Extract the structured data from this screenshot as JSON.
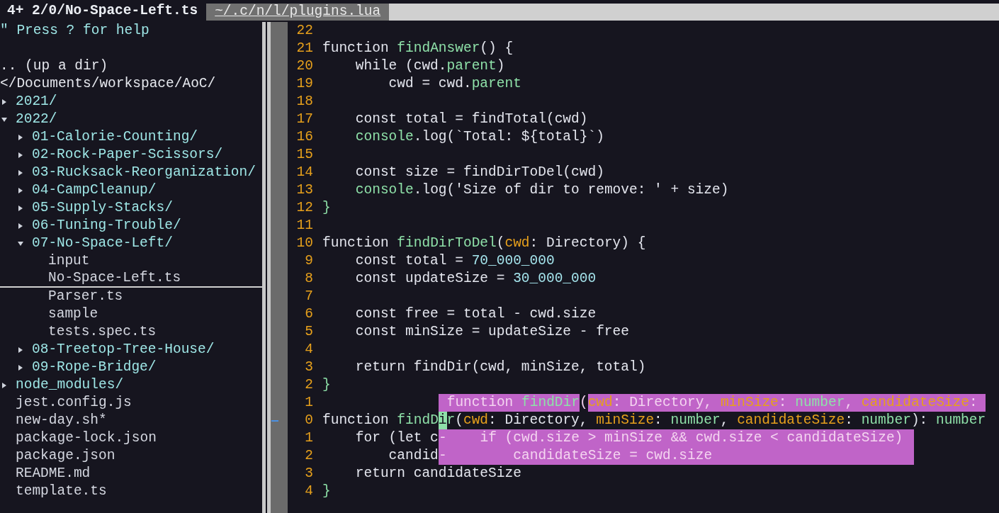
{
  "tabs": [
    {
      "label": "4+ 2/0/No-Space-Left.ts",
      "selected": true
    },
    {
      "label": "~/.c/n/l/plugins.lua",
      "selected": false
    }
  ],
  "tree": {
    "help": "\" Press ? for help",
    "up": ".. (up a dir)",
    "root": "</Documents/workspace/AoC/",
    "items": [
      {
        "name": "2021/",
        "kind": "dir",
        "expanded": false,
        "selected": false
      },
      {
        "name": "2022/",
        "kind": "dir",
        "expanded": true,
        "selected": false,
        "children": [
          {
            "name": "01-Calorie-Counting/",
            "kind": "dir",
            "expanded": false,
            "selected": false
          },
          {
            "name": "02-Rock-Paper-Scissors/",
            "kind": "dir",
            "expanded": false,
            "selected": false
          },
          {
            "name": "03-Rucksack-Reorganization/",
            "kind": "dir",
            "expanded": false,
            "selected": false
          },
          {
            "name": "04-CampCleanup/",
            "kind": "dir",
            "expanded": false,
            "selected": false
          },
          {
            "name": "05-Supply-Stacks/",
            "kind": "dir",
            "expanded": false,
            "selected": false
          },
          {
            "name": "06-Tuning-Trouble/",
            "kind": "dir",
            "expanded": false,
            "selected": false
          },
          {
            "name": "07-No-Space-Left/",
            "kind": "dir",
            "expanded": true,
            "selected": false,
            "children": [
              {
                "name": "input",
                "kind": "file",
                "selected": false
              },
              {
                "name": "No-Space-Left.ts",
                "kind": "file",
                "selected": true
              },
              {
                "name": "Parser.ts",
                "kind": "file",
                "selected": false
              },
              {
                "name": "sample",
                "kind": "file",
                "selected": false
              },
              {
                "name": "tests.spec.ts",
                "kind": "file",
                "selected": false
              }
            ]
          },
          {
            "name": "08-Treetop-Tree-House/",
            "kind": "dir",
            "expanded": false,
            "selected": false
          },
          {
            "name": "09-Rope-Bridge/",
            "kind": "dir",
            "expanded": false,
            "selected": false
          }
        ]
      },
      {
        "name": "node_modules/",
        "kind": "dir",
        "expanded": false,
        "selected": false
      },
      {
        "name": "jest.config.js",
        "kind": "file",
        "selected": false
      },
      {
        "name": "new-day.sh*",
        "kind": "file",
        "selected": false
      },
      {
        "name": "package-lock.json",
        "kind": "file",
        "selected": false
      },
      {
        "name": "package.json",
        "kind": "file",
        "selected": false
      },
      {
        "name": "README.md",
        "kind": "file",
        "selected": false
      },
      {
        "name": "template.ts",
        "kind": "file",
        "selected": false
      }
    ]
  },
  "code": {
    "lines": [
      {
        "number": "22"
      },
      {
        "number": "21",
        "segments": [
          {
            "text": "function ",
            "kind": "plain"
          },
          {
            "text": "findAnswer",
            "kind": "function"
          },
          {
            "text": "() {",
            "kind": "plain"
          }
        ]
      },
      {
        "number": "20",
        "segments": [
          {
            "text": "    while (cwd.",
            "kind": "plain"
          },
          {
            "text": "parent",
            "kind": "property"
          },
          {
            "text": ")",
            "kind": "plain"
          }
        ]
      },
      {
        "number": "19",
        "segments": [
          {
            "text": "        cwd = cwd.",
            "kind": "plain"
          },
          {
            "text": "parent",
            "kind": "property"
          }
        ]
      },
      {
        "number": "18"
      },
      {
        "number": "17",
        "segments": [
          {
            "text": "    const total = findTotal(cwd)",
            "kind": "plain"
          }
        ]
      },
      {
        "number": "16",
        "segments": [
          {
            "text": "    console",
            "kind": "property"
          },
          {
            "text": ".log(`Total: ${total}`)",
            "kind": "plain"
          }
        ]
      },
      {
        "number": "15"
      },
      {
        "number": "14",
        "segments": [
          {
            "text": "    const size = findDirToDel(cwd)",
            "kind": "plain"
          }
        ]
      },
      {
        "number": "13",
        "segments": [
          {
            "text": "    console",
            "kind": "property"
          },
          {
            "text": ".log('Size of dir to remove: ' + size)",
            "kind": "plain"
          }
        ]
      },
      {
        "number": "12",
        "segments": [
          {
            "text": "}",
            "kind": "brace"
          }
        ]
      },
      {
        "number": "11"
      },
      {
        "number": "10",
        "segments": [
          {
            "text": "function ",
            "kind": "plain"
          },
          {
            "text": "findDirToDel",
            "kind": "function"
          },
          {
            "text": "(",
            "kind": "plain"
          },
          {
            "text": "cwd",
            "kind": "param"
          },
          {
            "text": ": Directory) {",
            "kind": "plain"
          }
        ]
      },
      {
        "number": "9",
        "segments": [
          {
            "text": "    const total = ",
            "kind": "plain"
          },
          {
            "text": "70_000_000",
            "kind": "number"
          }
        ]
      },
      {
        "number": "8",
        "segments": [
          {
            "text": "    const updateSize = ",
            "kind": "plain"
          },
          {
            "text": "30_000_000",
            "kind": "number"
          }
        ]
      },
      {
        "number": "7"
      },
      {
        "number": "6",
        "segments": [
          {
            "text": "    const free = total - cwd.size",
            "kind": "plain"
          }
        ]
      },
      {
        "number": "5",
        "segments": [
          {
            "text": "    const minSize = updateSize - free",
            "kind": "plain"
          }
        ]
      },
      {
        "number": "4"
      },
      {
        "number": "3",
        "segments": [
          {
            "text": "    return findDir(cwd, minSize, total)",
            "kind": "plain"
          }
        ]
      },
      {
        "number": "2",
        "segments": [
          {
            "text": "}",
            "kind": "brace"
          }
        ]
      },
      {
        "number": "1"
      },
      {
        "number": "0",
        "sign": true,
        "segments": [
          {
            "text": "function ",
            "kind": "plain"
          },
          {
            "text": "findD",
            "kind": "function"
          },
          {
            "text": "i",
            "kind": "function",
            "cursor": true
          },
          {
            "text": "r",
            "kind": "function"
          },
          {
            "text": "(",
            "kind": "plain"
          },
          {
            "text": "cwd",
            "kind": "param"
          },
          {
            "text": ": Directory, ",
            "kind": "plain"
          },
          {
            "text": "minSize",
            "kind": "param"
          },
          {
            "text": ": ",
            "kind": "plain"
          },
          {
            "text": "number",
            "kind": "type"
          },
          {
            "text": ", ",
            "kind": "plain"
          },
          {
            "text": "candidateSize",
            "kind": "param"
          },
          {
            "text": ": ",
            "kind": "plain"
          },
          {
            "text": "number",
            "kind": "type"
          },
          {
            "text": "): ",
            "kind": "plain"
          },
          {
            "text": "number",
            "kind": "type"
          }
        ]
      },
      {
        "number": "1",
        "segments": [
          {
            "text": "    for (let c",
            "kind": "plain"
          }
        ]
      },
      {
        "number": "2",
        "segments": [
          {
            "text": "        candid",
            "kind": "plain"
          }
        ]
      },
      {
        "number": "3",
        "segments": [
          {
            "text": "    return candidateSize",
            "kind": "plain"
          }
        ]
      },
      {
        "number": "4",
        "segments": [
          {
            "text": "}",
            "kind": "brace"
          }
        ]
      }
    ]
  },
  "signature_popup": {
    "segments": [
      {
        "text": " function ",
        "kind": "plain"
      },
      {
        "text": "findDir",
        "kind": "function"
      },
      {
        "text": "(",
        "kind": "plain",
        "popup_ground": false
      },
      {
        "text": "cwd",
        "kind": "param"
      },
      {
        "text": ": Directory, ",
        "kind": "plain"
      },
      {
        "text": "minSize",
        "kind": "param"
      },
      {
        "text": ": ",
        "kind": "plain"
      },
      {
        "text": "number",
        "kind": "type"
      },
      {
        "text": ", ",
        "kind": "plain"
      },
      {
        "text": "candidateSize",
        "kind": "param"
      },
      {
        "text": ": ",
        "kind": "plain"
      }
    ]
  },
  "preview_popup": {
    "lines": [
      "-    if (cwd.size > minSize && cwd.size < candidateSize)",
      "-        candidateSize = cwd.size"
    ]
  }
}
